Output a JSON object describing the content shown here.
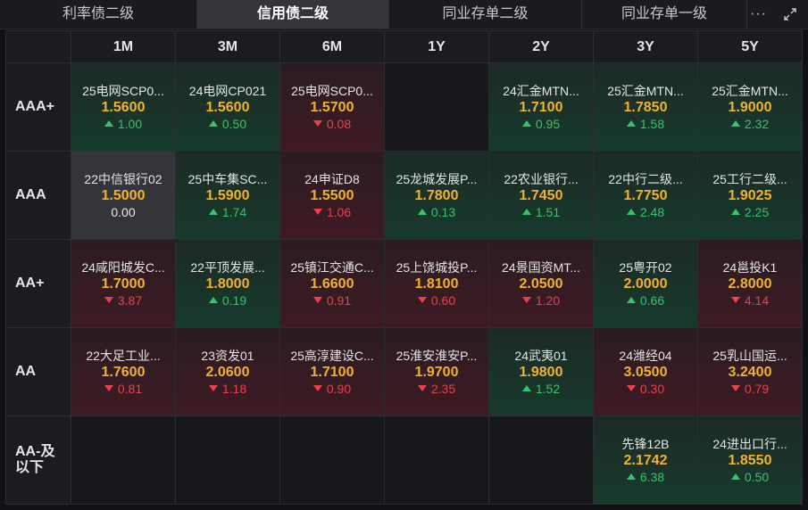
{
  "tabs": [
    "利率债二级",
    "信用债二级",
    "同业存单二级",
    "同业存单一级"
  ],
  "active_tab": 1,
  "tenors": [
    "1M",
    "3M",
    "6M",
    "1Y",
    "2Y",
    "3Y",
    "5Y"
  ],
  "ratings": [
    "AAA+",
    "AAA",
    "AA+",
    "AA",
    "AA-及\n以下"
  ],
  "cells": [
    [
      {
        "name": "25电网SCP0...",
        "rate": "1.5600",
        "chg": "1.00",
        "dir": "up"
      },
      {
        "name": "24电网CP021",
        "rate": "1.5600",
        "chg": "0.50",
        "dir": "up"
      },
      {
        "name": "25电网SCP0...",
        "rate": "1.5700",
        "chg": "0.08",
        "dir": "down"
      },
      null,
      {
        "name": "24汇金MTN...",
        "rate": "1.7100",
        "chg": "0.95",
        "dir": "up"
      },
      {
        "name": "25汇金MTN...",
        "rate": "1.7850",
        "chg": "1.58",
        "dir": "up"
      },
      {
        "name": "25汇金MTN...",
        "rate": "1.9000",
        "chg": "2.32",
        "dir": "up"
      }
    ],
    [
      {
        "name": "22中信银行02",
        "rate": "1.5000",
        "chg": "0.00",
        "dir": "flat"
      },
      {
        "name": "25中车集SC...",
        "rate": "1.5900",
        "chg": "1.74",
        "dir": "up"
      },
      {
        "name": "24申证D8",
        "rate": "1.5500",
        "chg": "1.06",
        "dir": "down"
      },
      {
        "name": "25龙城发展P...",
        "rate": "1.7800",
        "chg": "0.13",
        "dir": "up"
      },
      {
        "name": "22农业银行...",
        "rate": "1.7450",
        "chg": "1.51",
        "dir": "up"
      },
      {
        "name": "22中行二级...",
        "rate": "1.7750",
        "chg": "2.48",
        "dir": "up"
      },
      {
        "name": "25工行二级...",
        "rate": "1.9025",
        "chg": "2.25",
        "dir": "up"
      }
    ],
    [
      {
        "name": "24咸阳城发C...",
        "rate": "1.7000",
        "chg": "3.87",
        "dir": "down"
      },
      {
        "name": "22平顶发展...",
        "rate": "1.8000",
        "chg": "0.19",
        "dir": "up"
      },
      {
        "name": "25镇江交通C...",
        "rate": "1.6600",
        "chg": "0.91",
        "dir": "down"
      },
      {
        "name": "25上饶城投P...",
        "rate": "1.8100",
        "chg": "0.60",
        "dir": "down"
      },
      {
        "name": "24景国资MT...",
        "rate": "2.0500",
        "chg": "1.20",
        "dir": "down"
      },
      {
        "name": "25粤开02",
        "rate": "2.0000",
        "chg": "0.66",
        "dir": "up"
      },
      {
        "name": "24邕投K1",
        "rate": "2.8000",
        "chg": "4.14",
        "dir": "down"
      }
    ],
    [
      {
        "name": "22大足工业...",
        "rate": "1.7600",
        "chg": "0.81",
        "dir": "down"
      },
      {
        "name": "23资发01",
        "rate": "2.0600",
        "chg": "1.18",
        "dir": "down"
      },
      {
        "name": "25高淳建设C...",
        "rate": "1.7100",
        "chg": "0.90",
        "dir": "down"
      },
      {
        "name": "25淮安淮安P...",
        "rate": "1.9700",
        "chg": "2.35",
        "dir": "down"
      },
      {
        "name": "24武夷01",
        "rate": "1.9800",
        "chg": "1.52",
        "dir": "up"
      },
      {
        "name": "24潍经04",
        "rate": "3.0500",
        "chg": "0.30",
        "dir": "down"
      },
      {
        "name": "25乳山国运...",
        "rate": "3.2400",
        "chg": "0.79",
        "dir": "down"
      }
    ],
    [
      null,
      null,
      null,
      null,
      null,
      {
        "name": "先锋12B",
        "rate": "2.1742",
        "chg": "6.38",
        "dir": "up"
      },
      {
        "name": "24进出口行...",
        "rate": "1.8550",
        "chg": "0.50",
        "dir": "up"
      }
    ]
  ],
  "colors": {
    "rate": "#f2b22e",
    "up": "#36c46b",
    "down": "#ee3e4f"
  },
  "icons": {
    "more": "more-icon",
    "expand": "expand-icon"
  }
}
